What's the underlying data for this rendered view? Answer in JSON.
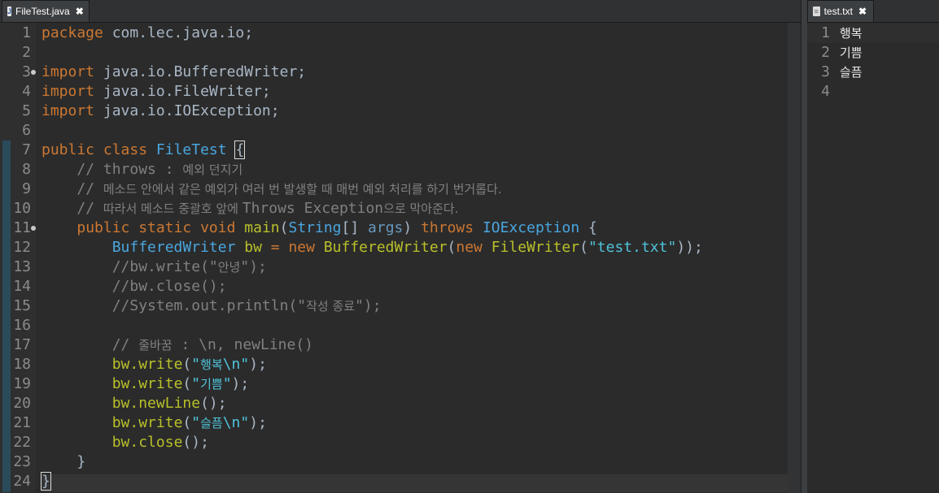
{
  "tabs": {
    "java": {
      "label": "FileTest.java",
      "icon": "java-file-icon",
      "close": "✖"
    },
    "txt": {
      "label": "test.txt",
      "icon": "text-file-icon",
      "close": "✖"
    }
  },
  "java_line_numbers": [
    "1",
    "2",
    "3",
    "4",
    "5",
    "6",
    "7",
    "8",
    "9",
    "10",
    "11",
    "12",
    "13",
    "14",
    "15",
    "16",
    "17",
    "18",
    "19",
    "20",
    "21",
    "22",
    "23",
    "24"
  ],
  "java_code": {
    "l1": {
      "kw": "package",
      "rest": " com.lec.java.io;"
    },
    "l3": {
      "kw": "import",
      "rest": " java.io.BufferedWriter;"
    },
    "l4": {
      "kw": "import",
      "rest": " java.io.FileWriter;"
    },
    "l5": {
      "kw": "import",
      "rest": " java.io.IOException;"
    },
    "l7": {
      "kw": "public class",
      "name": "FileTest",
      "brace": "{"
    },
    "l8": {
      "cm": "// throws : ",
      "ko": "예외 던지기"
    },
    "l9": {
      "cm": "// ",
      "ko": "메소드 안에서 같은 예외가 여러 번 발생할 때 매번 예외 처리를 하기 번거롭다."
    },
    "l10": {
      "cm": "// ",
      "ko1": "따라서 메소드 중괄호 앞에 ",
      "cm2": "Throws Exception",
      "ko2": "으로 막아준다."
    },
    "l11": {
      "kw1": "public static void",
      "fn": "main",
      "p1": "(",
      "ty": "String",
      "p2": "[] ",
      "args": "args",
      "p3": ") ",
      "kw2": "throws",
      "ex": "IOException",
      "p4": " {"
    },
    "l12": {
      "ty": "BufferedWriter",
      "var": " bw",
      "eq": " = ",
      "kw1": "new",
      "fn1": "BufferedWriter",
      "p1": "(",
      "kw2": "new",
      "fn2": "FileWriter",
      "p2": "(",
      "str": "\"test.txt\"",
      "p3": "));"
    },
    "l13": {
      "a": "//bw.write(\"",
      "ko": "안녕",
      "b": "\");"
    },
    "l14": {
      "a": "//bw.close();"
    },
    "l15": {
      "a": "//System.out.println(\"",
      "ko": "작성 종료",
      "b": "\");"
    },
    "l17": {
      "a": "// ",
      "ko": "줄바꿈",
      "b": " : \\n, newLine()"
    },
    "l18": {
      "obj": "bw.",
      "fn": "write",
      "p1": "(",
      "q1": "\"",
      "ko": "행복",
      "esc": "\\n",
      "q2": "\"",
      "p2": ");"
    },
    "l19": {
      "obj": "bw.",
      "fn": "write",
      "p1": "(",
      "q1": "\"",
      "ko": "기쁨",
      "q2": "\"",
      "p2": ");"
    },
    "l20": {
      "obj": "bw.",
      "fn": "newLine",
      "p": "();"
    },
    "l21": {
      "obj": "bw.",
      "fn": "write",
      "p1": "(",
      "q1": "\"",
      "ko": "슬픔",
      "esc": "\\n",
      "q2": "\"",
      "p2": ");"
    },
    "l22": {
      "obj": "bw.",
      "fn": "close",
      "p": "();"
    },
    "l23": {
      "brace": "}"
    },
    "l24": {
      "brace": "}"
    }
  },
  "txt_line_numbers": [
    "1",
    "2",
    "3",
    "4"
  ],
  "txt_lines": [
    "행복",
    "기쁨",
    "슬픔",
    ""
  ],
  "colors": {
    "keyword": "#cc7832",
    "type": "#6897bb",
    "function": "#b9c02a",
    "string": "#4fc3d9",
    "comment": "#808080",
    "background": "#2b2b2b"
  }
}
